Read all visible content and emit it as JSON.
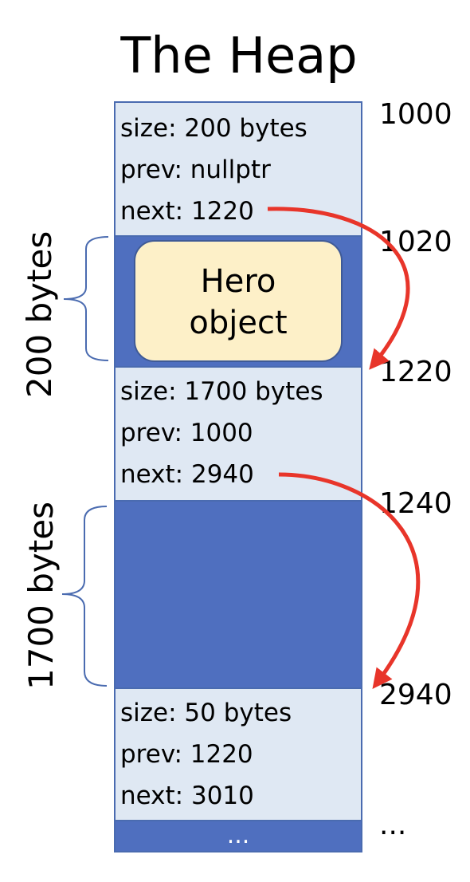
{
  "title": "The Heap",
  "blocks": [
    {
      "size": "size: 200 bytes",
      "prev": "prev: nullptr",
      "next": "next: 1220"
    },
    {
      "size": "size: 1700 bytes",
      "prev": "prev: 1000",
      "next": "next: 2940"
    },
    {
      "size": "size: 50 bytes",
      "prev": "prev: 1220",
      "next": "next: 3010"
    }
  ],
  "hero": {
    "line1": "Hero",
    "line2": "object"
  },
  "addresses": [
    "1000",
    "1020",
    "1220",
    "1240",
    "2940",
    "..."
  ],
  "bottom_ellipsis": "...",
  "braces": {
    "upper": "200 bytes",
    "lower": "1700 bytes"
  },
  "colors": {
    "header_fill": "#dfe8f3",
    "payload_fill": "#4f6fbf",
    "hero_fill": "#fdf0c8",
    "arrow": "#e8352a",
    "brace": "#4a6bb0"
  }
}
